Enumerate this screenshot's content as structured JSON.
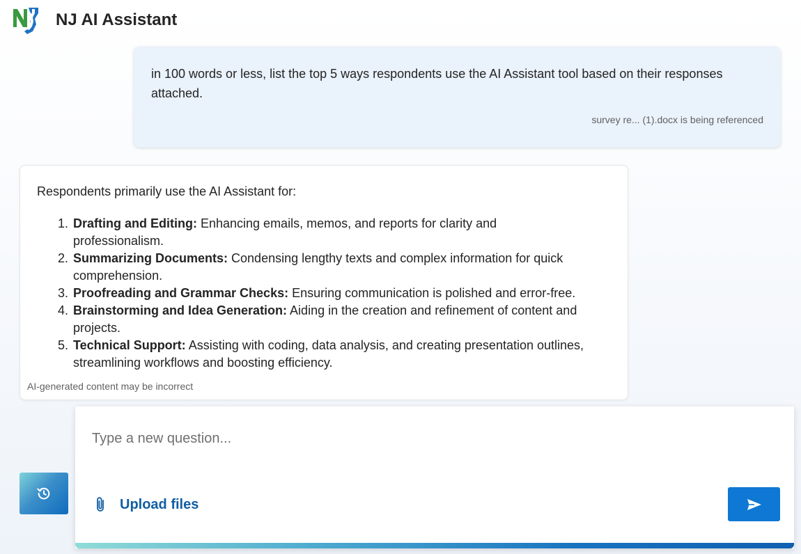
{
  "app": {
    "title": "NJ AI Assistant",
    "logo_text": "NJ"
  },
  "user_message": {
    "text": "in 100 words or less, list the top 5 ways respondents use the AI Assistant tool based on their responses attached.",
    "reference": "survey re... (1).docx is being referenced"
  },
  "assistant_message": {
    "intro": "Respondents primarily use the AI Assistant for:",
    "items": [
      {
        "title": "Drafting and Editing:",
        "text": " Enhancing emails, memos, and reports for clarity and professionalism."
      },
      {
        "title": "Summarizing Documents:",
        "text": " Condensing lengthy texts and complex information for quick comprehension."
      },
      {
        "title": "Proofreading and Grammar Checks:",
        "text": " Ensuring communication is polished and error-free."
      },
      {
        "title": "Brainstorming and Idea Generation:",
        "text": " Aiding in the creation and refinement of content and projects."
      },
      {
        "title": "Technical Support:",
        "text": " Assisting with coding, data analysis, and creating presentation outlines, streamlining workflows and boosting efficiency."
      }
    ],
    "disclaimer": "AI-generated content may be incorrect"
  },
  "composer": {
    "placeholder": "Type a new question...",
    "value": "",
    "upload_label": "Upload files",
    "history_icon": "history-icon",
    "attach_icon": "paperclip-icon",
    "send_icon": "send-icon"
  },
  "colors": {
    "accent": "#0f78d4",
    "link": "#115ea3",
    "user_bubble": "#eaf2fb",
    "logo_green": "#3a9a3f",
    "logo_blue": "#1f73c4"
  }
}
